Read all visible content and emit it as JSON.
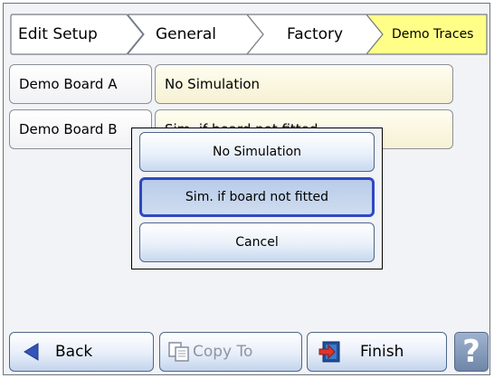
{
  "breadcrumb": {
    "items": [
      {
        "label": "Edit Setup",
        "fill": "#ffffff"
      },
      {
        "label": "General",
        "fill": "#ffffff"
      },
      {
        "label": "Factory",
        "fill": "#ffffff"
      },
      {
        "label": "Demo Traces",
        "fill": "#ffff88"
      }
    ]
  },
  "settings": {
    "rows": [
      {
        "label": "Demo Board A",
        "value": "No Simulation"
      },
      {
        "label": "Demo Board B",
        "value": "Sim. if board not fitted"
      }
    ]
  },
  "popup": {
    "options": [
      {
        "label": "No Simulation",
        "selected": false
      },
      {
        "label": "Sim. if board not fitted",
        "selected": true
      },
      {
        "label": "Cancel",
        "selected": false
      }
    ]
  },
  "toolbar": {
    "back_label": "Back",
    "back_icon": "left-arrow-icon",
    "copy_label": "Copy To",
    "copy_icon": "copy-icon",
    "copy_enabled": false,
    "finish_label": "Finish",
    "finish_icon": "exit-door-icon",
    "help_label": "?"
  },
  "colors": {
    "accent": "#2f49c2",
    "tab_active": "#ffff88",
    "value_bg": "#f6f1d3"
  }
}
